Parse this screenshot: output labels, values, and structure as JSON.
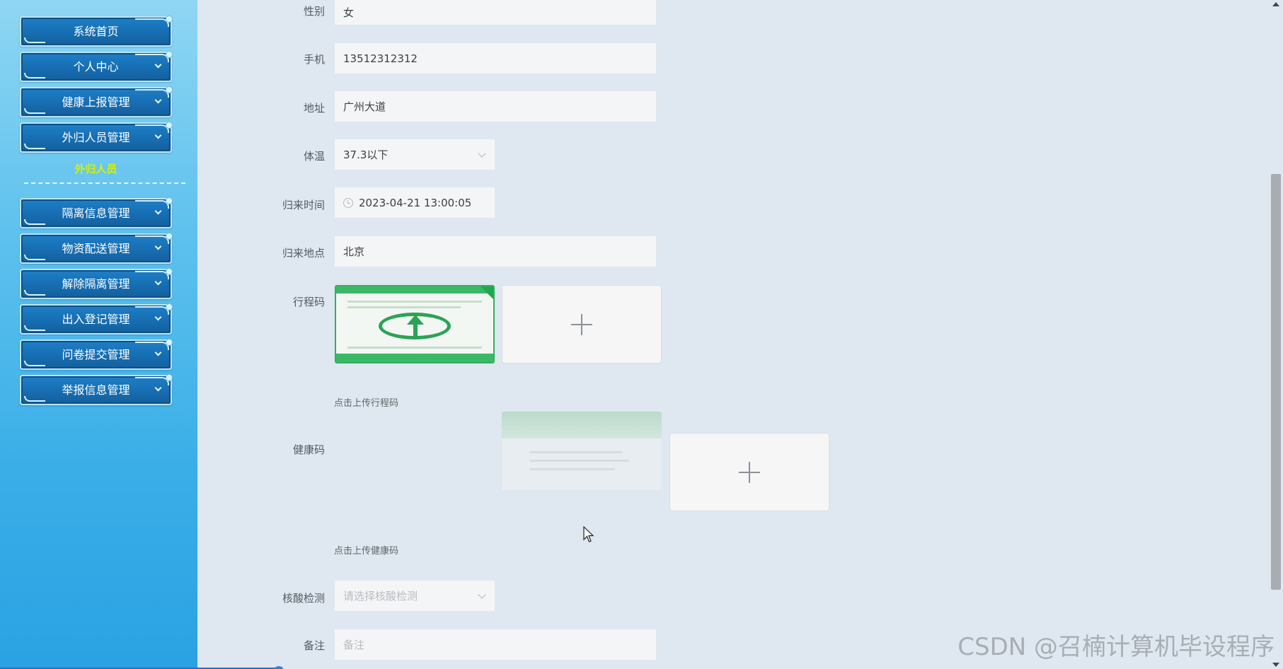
{
  "sidebar": {
    "items": [
      {
        "label": "系统首页"
      },
      {
        "label": "个人中心"
      },
      {
        "label": "健康上报管理"
      },
      {
        "label": "外归人员管理"
      },
      {
        "label": "隔离信息管理"
      },
      {
        "label": "物资配送管理"
      },
      {
        "label": "解除隔离管理"
      },
      {
        "label": "出入登记管理"
      },
      {
        "label": "问卷提交管理"
      },
      {
        "label": "举报信息管理"
      }
    ],
    "submenu_active": "外归人员",
    "accent_color": "#d6f000"
  },
  "form": {
    "gender": {
      "label": "性别",
      "value": "女"
    },
    "phone": {
      "label": "手机",
      "value": "13512312312"
    },
    "address": {
      "label": "地址",
      "value": "广州大道"
    },
    "temperature": {
      "label": "体温",
      "value": "37.3以下"
    },
    "return_time": {
      "label": "归来时间",
      "value": "2023-04-21 13:00:05"
    },
    "return_place": {
      "label": "归来地点",
      "value": "北京"
    },
    "trip_code": {
      "label": "行程码",
      "hint": "点击上传行程码"
    },
    "health_code": {
      "label": "健康码",
      "hint": "点击上传健康码"
    },
    "nucleic_test": {
      "label": "核酸检测",
      "placeholder": "请选择核酸检测"
    },
    "remark": {
      "label": "备注",
      "placeholder": "备注"
    }
  },
  "watermark": "CSDN @召楠计算机毕设程序"
}
